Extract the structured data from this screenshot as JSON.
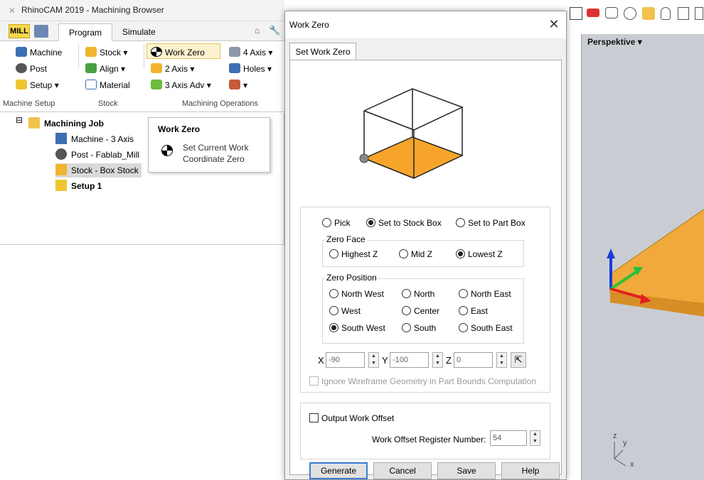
{
  "browser": {
    "title": "RhinoCAM 2019 - Machining Browser",
    "mill_label": "MILL",
    "tabs": [
      "Program",
      "Simulate"
    ],
    "ribbon": {
      "machine": "Machine",
      "post": "Post",
      "setup": "Setup ▾",
      "stock": "Stock ▾",
      "align": "Align ▾",
      "material": "Material",
      "work_zero": "Work Zero",
      "two_axis": "2 Axis ▾",
      "three_axis_adv": "3 Axis Adv ▾",
      "four_axis": "4 Axis ▾",
      "holes": "Holes ▾",
      "tools": "▾",
      "groups": [
        "Machine Setup",
        "Stock",
        "Machining Operations"
      ]
    },
    "tree": {
      "root": "Machining Job",
      "items": [
        "Machine - 3 Axis",
        "Post - Fablab_Mill",
        "Stock - Box Stock"
      ],
      "setup": "Setup 1",
      "expander": "⊟"
    },
    "tooltip": {
      "title": "Work Zero",
      "line1": "Set Current Work",
      "line2": "Coordinate Zero"
    }
  },
  "dialog": {
    "title": "Work Zero",
    "close": "✕",
    "tab": "Set Work Zero",
    "mode": {
      "options": [
        "Pick",
        "Set to Stock Box",
        "Set to Part Box"
      ],
      "selected": "Set to Stock Box"
    },
    "zero_face": {
      "caption": "Zero Face",
      "options": [
        "Highest Z",
        "Mid Z",
        "Lowest Z"
      ],
      "selected": "Lowest Z"
    },
    "zero_position": {
      "caption": "Zero Position",
      "options": [
        "North West",
        "North",
        "North East",
        "West",
        "Center",
        "East",
        "South West",
        "South",
        "South East"
      ],
      "selected": "South West"
    },
    "coords": {
      "x_label": "X",
      "x_value": "-90",
      "y_label": "Y",
      "y_value": "-100",
      "z_label": "Z",
      "z_value": "0"
    },
    "ignore_wireframe": "Ignore Wireframe Geometry in Part Bounds Computation",
    "output_offset": "Output Work Offset",
    "offset_register_label": "Work Offset Register Number:",
    "offset_register_value": "54",
    "buttons": [
      "Generate",
      "Cancel",
      "Save",
      "Help"
    ]
  },
  "viewport": {
    "label": "Perspektive",
    "axis_z": "z",
    "axis_y": "y",
    "axis_x": "x"
  },
  "colors": {
    "stock_orange": "#f5a623",
    "viewport_bg": "#c9cdd3",
    "accent_blue": "#3c7fd1"
  }
}
